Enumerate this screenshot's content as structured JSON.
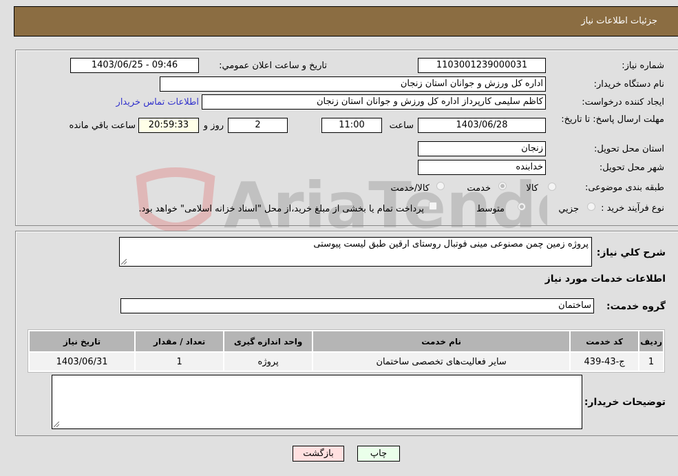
{
  "header": {
    "title": "جزئیات اطلاعات نیاز"
  },
  "details": {
    "need_number": {
      "label": "شماره نیاز:",
      "value": "1103001239000031"
    },
    "announce_datetime": {
      "label": "تاریخ و ساعت اعلان عمومي:",
      "value": "1403/06/25 - 09:46"
    },
    "buyer_org": {
      "label": "نام دستگاه خریدار:",
      "value": "اداره کل ورزش و جوانان استان زنجان"
    },
    "requester": {
      "label": "ایجاد کننده درخواست:",
      "value": "کاظم سلیمی کارپرداز اداره کل ورزش و جوانان استان زنجان"
    },
    "buyer_contact_link": "اطلاعات تماس خریدار",
    "deadline": {
      "label": "مهلت ارسال پاسخ: تا تاریخ:",
      "date": "1403/06/28",
      "time_label": "ساعت",
      "time": "11:00",
      "days": "2",
      "days_label": "روز و",
      "remaining": "20:59:33",
      "remaining_label": "ساعت باقي مانده"
    },
    "delivery_province": {
      "label": "استان محل تحویل:",
      "value": "زنجان"
    },
    "delivery_city": {
      "label": "شهر محل تحویل:",
      "value": "خدابنده"
    },
    "category": {
      "label": "طبقه بندی موضوعی:",
      "options": [
        "کالا",
        "خدمت",
        "کالا/خدمت"
      ],
      "selected": "خدمت"
    },
    "purchase_type": {
      "label": "نوع فرآیند خرید :",
      "options": [
        "جزيي",
        "متوسط"
      ],
      "selected": "متوسط",
      "treasury_note": "پرداخت تمام یا بخشی از مبلغ خرید،از محل \"اسناد خزانه اسلامی\" خواهد بود."
    }
  },
  "summary": {
    "label": "شرح كلي نياز:",
    "value": "پروژه زمین چمن مصنوعی مینی فوتبال روستای ارقین طبق لیست پیوستی"
  },
  "services": {
    "section_title": "اطلاعات خدمات مورد نیاز",
    "group_label": "گروه خدمت:",
    "group_value": "ساختمان",
    "columns": [
      "ردیف",
      "کد خدمت",
      "نام خدمت",
      "واحد اندازه گیری",
      "تعداد / مقدار",
      "تاریخ نیاز"
    ],
    "rows": [
      [
        "1",
        "ج-43-439",
        "سایر فعالیت‌های تخصصی ساختمان",
        "پروژه",
        "1",
        "1403/06/31"
      ]
    ]
  },
  "buyer_notes": {
    "label": "توضیحات خریدار:",
    "value": ""
  },
  "buttons": {
    "print": "چاپ",
    "back": "بازگشت"
  },
  "watermark": {
    "text": "AriaTender.neT"
  }
}
